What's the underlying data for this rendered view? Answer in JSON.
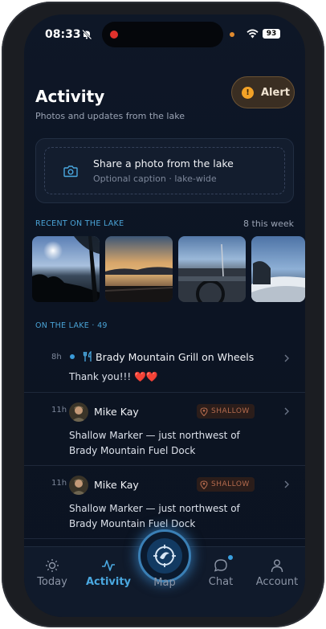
{
  "status_bar": {
    "time": "08:33",
    "battery": "93"
  },
  "header": {
    "title": "Activity",
    "subtitle": "Photos and updates from the lake",
    "alert_label": "Alert",
    "alert_icon_text": "!"
  },
  "share": {
    "title": "Share a photo from the lake",
    "caption": "Optional caption · lake-wide"
  },
  "recent": {
    "label": "RECENT ON THE LAKE",
    "count": "8 this week"
  },
  "feed": {
    "label": "ON THE LAKE · 49",
    "items": [
      {
        "time": "8h",
        "title": "Brady Mountain Grill on Wheels",
        "body": "Thank you!!! ❤️❤️"
      },
      {
        "time": "11h",
        "title": "Mike Kay",
        "badge": "SHALLOW",
        "body_line1": "Shallow Marker — just northwest of",
        "body_line2": "Brady Mountain Fuel Dock"
      },
      {
        "time": "11h",
        "title": "Mike Kay",
        "badge": "SHALLOW",
        "body_line1": "Shallow Marker — just northwest of",
        "body_line2": "Brady Mountain Fuel Dock"
      }
    ]
  },
  "tabs": [
    {
      "label": "Today",
      "icon": "sun-icon"
    },
    {
      "label": "Activity",
      "icon": "activity-icon",
      "active": true
    },
    {
      "label": "Map",
      "icon": "compass-icon"
    },
    {
      "label": "Chat",
      "icon": "chat-icon"
    },
    {
      "label": "Account",
      "icon": "person-icon"
    }
  ],
  "colors": {
    "accent": "#4aa8e0",
    "background": "#0c1423",
    "alert": "#f2a227",
    "badge": "#b46b4e"
  }
}
